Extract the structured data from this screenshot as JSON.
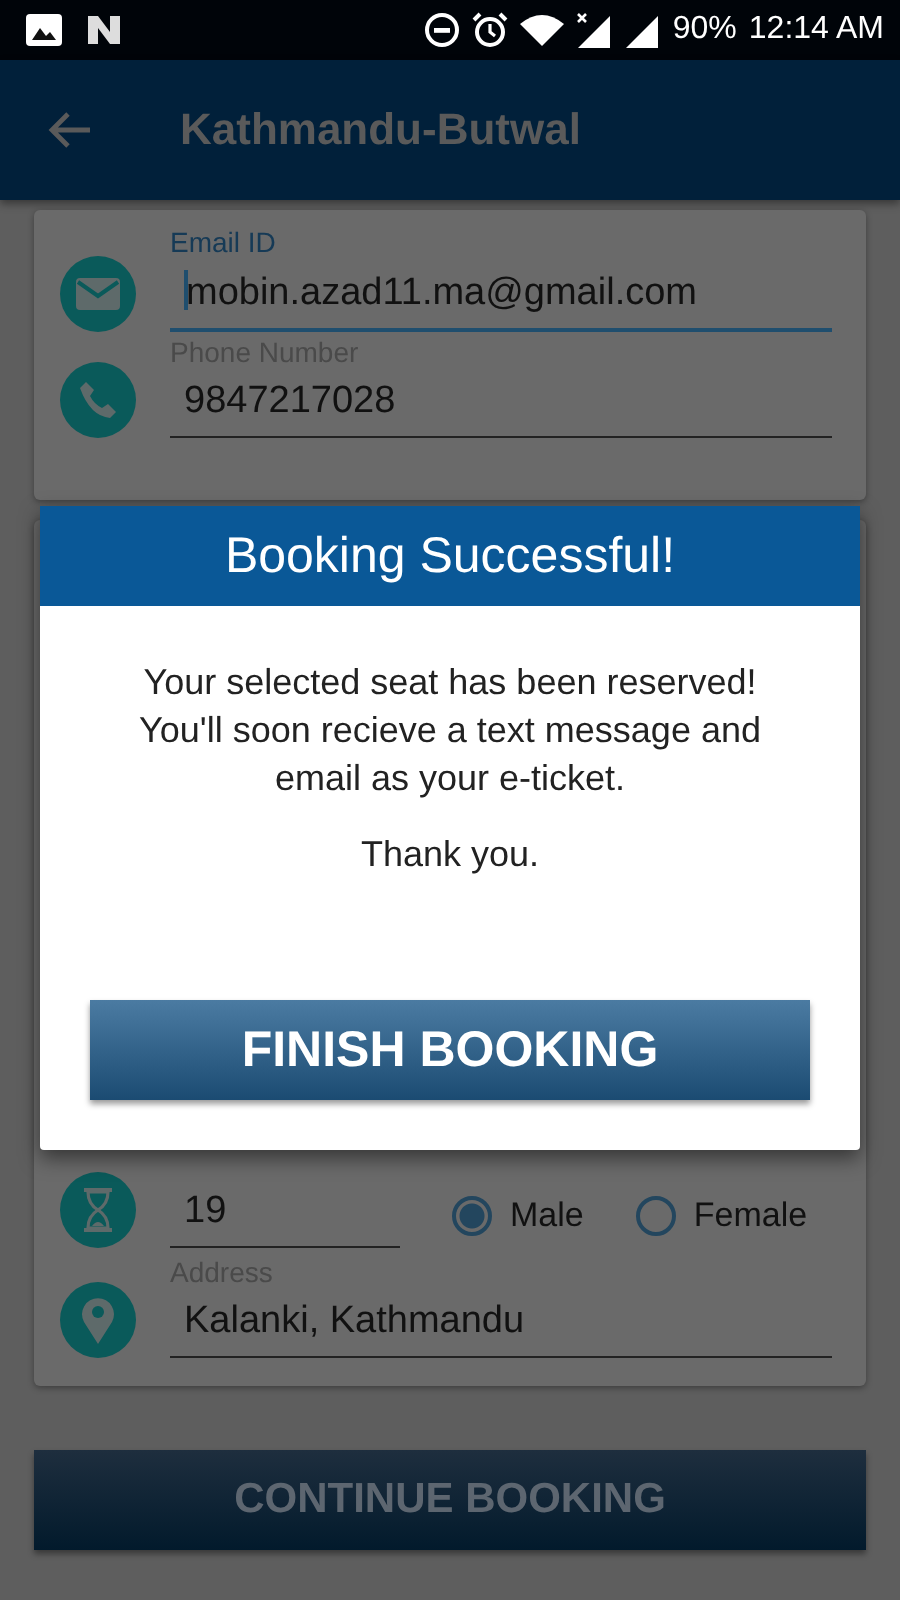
{
  "status_bar": {
    "battery": "90%",
    "time": "12:14 AM"
  },
  "app_bar": {
    "title": "Kathmandu-Butwal"
  },
  "contact_card": {
    "fields": [
      {
        "label": "Email ID",
        "value": "mobin.azad11.ma@gmail.com",
        "focused": true
      },
      {
        "label": "Phone Number",
        "value": "9847217028",
        "focused": false
      }
    ]
  },
  "personal_card": {
    "age": {
      "value": "19"
    },
    "gender": [
      {
        "label": "Male",
        "selected": true
      },
      {
        "label": "Female",
        "selected": false
      }
    ],
    "address": {
      "label": "Address",
      "value": "Kalanki, Kathmandu"
    }
  },
  "continue_button": "CONTINUE BOOKING",
  "dialog": {
    "title": "Booking Successful!",
    "message": "Your selected seat has been reserved! You'll soon recieve a text message and email as your e-ticket.",
    "closing": "Thank you.",
    "button": "FINISH BOOKING"
  }
}
